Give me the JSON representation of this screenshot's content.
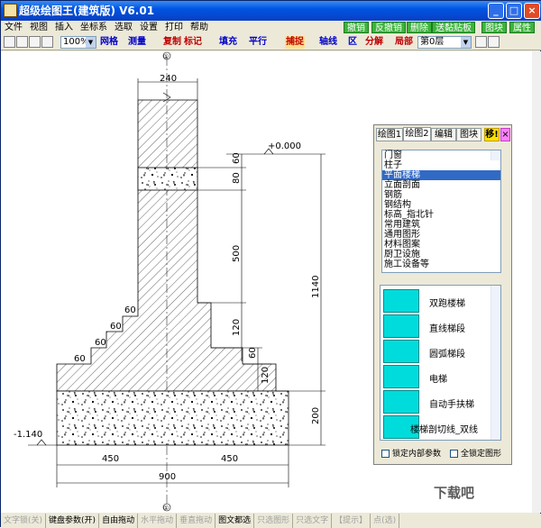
{
  "window": {
    "title": "超级绘图王(建筑版) V6.01",
    "min": "_",
    "max": "□",
    "close": "×"
  },
  "menu": {
    "items": [
      "文件",
      "视图",
      "插入",
      "坐标系",
      "选取",
      "设置",
      "打印",
      "帮助"
    ],
    "right_buttons": [
      "撤销",
      "反撤销",
      "删除",
      "送黏贴板",
      "图块",
      "属性"
    ]
  },
  "toolbar": {
    "zoom": "100%",
    "grid": "网格",
    "measure": "测量",
    "copy": "复制",
    "mark": "标记",
    "fill": "填充",
    "parallel": "平行",
    "snap": "捕捉",
    "axis": "轴线",
    "area": "区",
    "split": "分解",
    "local": "局部",
    "layer": "第0层"
  },
  "panel": {
    "tabs": [
      "绘图1",
      "绘图2",
      "编辑",
      "图块",
      "移!"
    ],
    "close": "×",
    "categories": [
      "门窗",
      "柱子",
      "平面楼梯",
      "立面剖面",
      "钢筋",
      "钢结构",
      "标高_指北针",
      "常用建筑",
      "通用图形",
      "材料图案",
      "厨卫设施",
      "施工设备等"
    ],
    "selected": "平面楼梯",
    "icons": [
      {
        "label": "双跑楼梯"
      },
      {
        "label": "直线梯段"
      },
      {
        "label": "圆弧梯段"
      },
      {
        "label": "电梯"
      },
      {
        "label": "自动手扶梯"
      },
      {
        "label": "楼梯剖切线_双线"
      }
    ],
    "lock_inner": "锁定内部参数",
    "lock_all": "全锁定图形"
  },
  "drawing": {
    "axis_top": "①",
    "axis_bottom": "①",
    "top_width": "240",
    "elevation_top": "+0.000",
    "elevation_bottom": "-1.140",
    "dims_right": [
      "60",
      "80",
      "500",
      "120",
      "60",
      "120"
    ],
    "dim_total": "1140",
    "dim_base": "200",
    "steps": [
      "60",
      "60",
      "60",
      "60"
    ],
    "bottom_left": "450",
    "bottom_right": "450",
    "bottom_total": "900"
  },
  "status": [
    "文字锁(关)",
    "键盘参数(开)",
    "自由拖动",
    "水平拖动",
    "垂直拖动",
    "图文都选",
    "只选图形",
    "只选文字",
    "【提示】",
    "点(选)"
  ],
  "watermark": "下载吧"
}
